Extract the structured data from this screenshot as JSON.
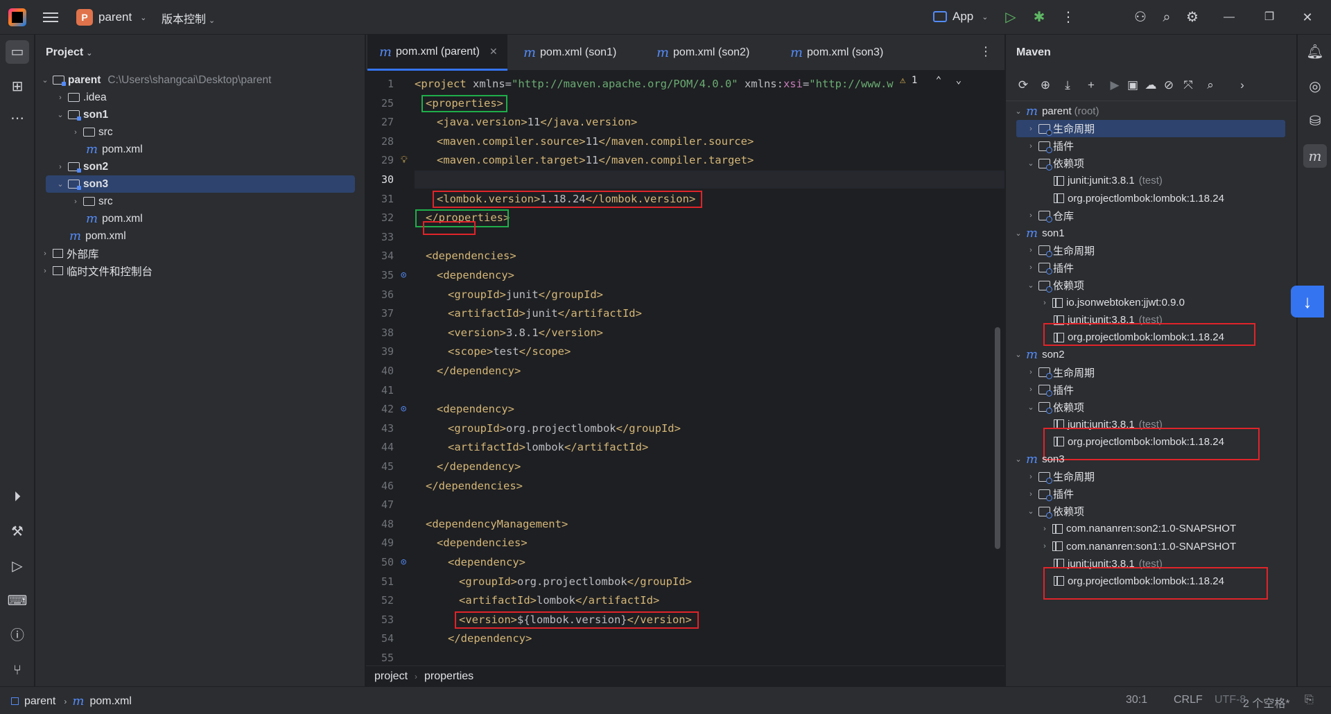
{
  "titlebar": {
    "project_badge": "P",
    "project_name": "parent",
    "vcs_label": "版本控制",
    "run_config": "App"
  },
  "project_panel": {
    "title": "Project",
    "tree": [
      {
        "label": "parent",
        "path": "C:\\Users\\shangcai\\Desktop\\parent"
      },
      {
        "label": ".idea"
      },
      {
        "label": "son1"
      },
      {
        "label": "src"
      },
      {
        "label": "pom.xml"
      },
      {
        "label": "son2"
      },
      {
        "label": "son3"
      },
      {
        "label": "src"
      },
      {
        "label": "pom.xml"
      },
      {
        "label": "pom.xml"
      },
      {
        "label": "外部库"
      },
      {
        "label": "临时文件和控制台"
      }
    ]
  },
  "editor": {
    "tabs": [
      {
        "label": "pom.xml (parent)"
      },
      {
        "label": "pom.xml (son1)"
      },
      {
        "label": "pom.xml (son2)"
      },
      {
        "label": "pom.xml (son3)"
      }
    ],
    "warning_count": "1",
    "lines": [
      {
        "n": "1",
        "parts": [
          [
            "tag",
            "<project "
          ],
          [
            "attr",
            "xmlns="
          ],
          [
            "str",
            "\"http://maven.apache.org/POM/4.0.0\""
          ],
          [
            "attr",
            " xmlns:"
          ],
          [
            "ns",
            "xsi"
          ],
          [
            "attr",
            "="
          ],
          [
            "str",
            "\"http://www.w"
          ]
        ]
      },
      {
        "n": "25",
        "parts": [
          [
            "tag",
            "<properties>"
          ]
        ]
      },
      {
        "n": "27",
        "parts": [
          [
            "tag",
            "<java.version>"
          ],
          [
            "txt",
            "11"
          ],
          [
            "tag",
            "</java.version>"
          ]
        ]
      },
      {
        "n": "28",
        "parts": [
          [
            "tag",
            "<maven.compiler.source>"
          ],
          [
            "txt",
            "11"
          ],
          [
            "tag",
            "</maven.compiler.source>"
          ]
        ]
      },
      {
        "n": "29",
        "parts": [
          [
            "tag",
            "<maven.compiler.target>"
          ],
          [
            "txt",
            "11"
          ],
          [
            "tag",
            "</maven.compiler.target>"
          ]
        ]
      },
      {
        "n": "30",
        "parts": []
      },
      {
        "n": "31",
        "parts": [
          [
            "tag",
            "<lombok.version>"
          ],
          [
            "txt",
            "1.18.24"
          ],
          [
            "tag",
            "</lombok.version>"
          ]
        ]
      },
      {
        "n": "32",
        "parts": [
          [
            "tag",
            "</properties>"
          ]
        ]
      },
      {
        "n": "33",
        "parts": []
      },
      {
        "n": "34",
        "parts": [
          [
            "tag",
            "<dependencies>"
          ]
        ]
      },
      {
        "n": "35",
        "parts": [
          [
            "tag",
            "<dependency>"
          ]
        ]
      },
      {
        "n": "36",
        "parts": [
          [
            "tag",
            "<groupId>"
          ],
          [
            "txt",
            "junit"
          ],
          [
            "tag",
            "</groupId>"
          ]
        ]
      },
      {
        "n": "37",
        "parts": [
          [
            "tag",
            "<artifactId>"
          ],
          [
            "txt",
            "junit"
          ],
          [
            "tag",
            "</artifactId>"
          ]
        ]
      },
      {
        "n": "38",
        "parts": [
          [
            "tag",
            "<version>"
          ],
          [
            "txt",
            "3.8.1"
          ],
          [
            "tag",
            "</version>"
          ]
        ]
      },
      {
        "n": "39",
        "parts": [
          [
            "tag",
            "<scope>"
          ],
          [
            "txt",
            "test"
          ],
          [
            "tag",
            "</scope>"
          ]
        ]
      },
      {
        "n": "40",
        "parts": [
          [
            "tag",
            "</dependency>"
          ]
        ]
      },
      {
        "n": "41",
        "parts": []
      },
      {
        "n": "42",
        "parts": [
          [
            "tag",
            "<dependency>"
          ]
        ]
      },
      {
        "n": "43",
        "parts": [
          [
            "tag",
            "<groupId>"
          ],
          [
            "txt",
            "org.projectlombok"
          ],
          [
            "tag",
            "</groupId>"
          ]
        ]
      },
      {
        "n": "44",
        "parts": [
          [
            "tag",
            "<artifactId>"
          ],
          [
            "txt",
            "lombok"
          ],
          [
            "tag",
            "</artifactId>"
          ]
        ]
      },
      {
        "n": "45",
        "parts": [
          [
            "tag",
            "</dependency>"
          ]
        ]
      },
      {
        "n": "46",
        "parts": [
          [
            "tag",
            "</dependencies>"
          ]
        ]
      },
      {
        "n": "47",
        "parts": []
      },
      {
        "n": "48",
        "parts": [
          [
            "tag",
            "<dependencyManagement>"
          ]
        ]
      },
      {
        "n": "49",
        "parts": [
          [
            "tag",
            "<dependencies>"
          ]
        ]
      },
      {
        "n": "50",
        "parts": [
          [
            "tag",
            "<dependency>"
          ]
        ]
      },
      {
        "n": "51",
        "parts": [
          [
            "tag",
            "<groupId>"
          ],
          [
            "txt",
            "org.projectlombok"
          ],
          [
            "tag",
            "</groupId>"
          ]
        ]
      },
      {
        "n": "52",
        "parts": [
          [
            "tag",
            "<artifactId>"
          ],
          [
            "txt",
            "lombok"
          ],
          [
            "tag",
            "</artifactId>"
          ]
        ]
      },
      {
        "n": "53",
        "parts": [
          [
            "tag",
            "<version>"
          ],
          [
            "txt",
            "${lombok.version}"
          ],
          [
            "tag",
            "</version>"
          ]
        ]
      },
      {
        "n": "54",
        "parts": [
          [
            "tag",
            "</dependency>"
          ]
        ]
      },
      {
        "n": "55",
        "parts": []
      }
    ],
    "breadcrumbs": [
      "project",
      "properties"
    ]
  },
  "maven": {
    "title": "Maven",
    "tree": [
      {
        "label": "parent",
        "extra": "(root)"
      },
      {
        "label": "生命周期"
      },
      {
        "label": "插件"
      },
      {
        "label": "依赖项"
      },
      {
        "label": "junit:junit:3.8.1",
        "extra": "(test)"
      },
      {
        "label": "org.projectlombok:lombok:1.18.24"
      },
      {
        "label": "仓库"
      },
      {
        "label": "son1"
      },
      {
        "label": "生命周期"
      },
      {
        "label": "插件"
      },
      {
        "label": "依赖项"
      },
      {
        "label": "io.jsonwebtoken:jjwt:0.9.0"
      },
      {
        "label": "junit:junit:3.8.1",
        "extra": "(test)"
      },
      {
        "label": "org.projectlombok:lombok:1.18.24"
      },
      {
        "label": "son2"
      },
      {
        "label": "生命周期"
      },
      {
        "label": "插件"
      },
      {
        "label": "依赖项"
      },
      {
        "label": "junit:junit:3.8.1",
        "extra": "(test)"
      },
      {
        "label": "org.projectlombok:lombok:1.18.24"
      },
      {
        "label": "son3"
      },
      {
        "label": "生命周期"
      },
      {
        "label": "插件"
      },
      {
        "label": "依赖项"
      },
      {
        "label": "com.nananren:son2:1.0-SNAPSHOT"
      },
      {
        "label": "com.nananren:son1:1.0-SNAPSHOT"
      },
      {
        "label": "junit:junit:3.8.1",
        "extra": "(test)"
      },
      {
        "label": "org.projectlombok:lombok:1.18.24"
      }
    ]
  },
  "statusbar": {
    "crumb_project": "parent",
    "crumb_file": "pom.xml",
    "caret": "30:1",
    "line_sep": "CRLF",
    "encoding": "UTF-8",
    "indent": "2 个空格*"
  },
  "colors": {
    "accent": "#3574f0",
    "annotation_red": "#e0242a",
    "annotation_green": "#1fae4a"
  }
}
